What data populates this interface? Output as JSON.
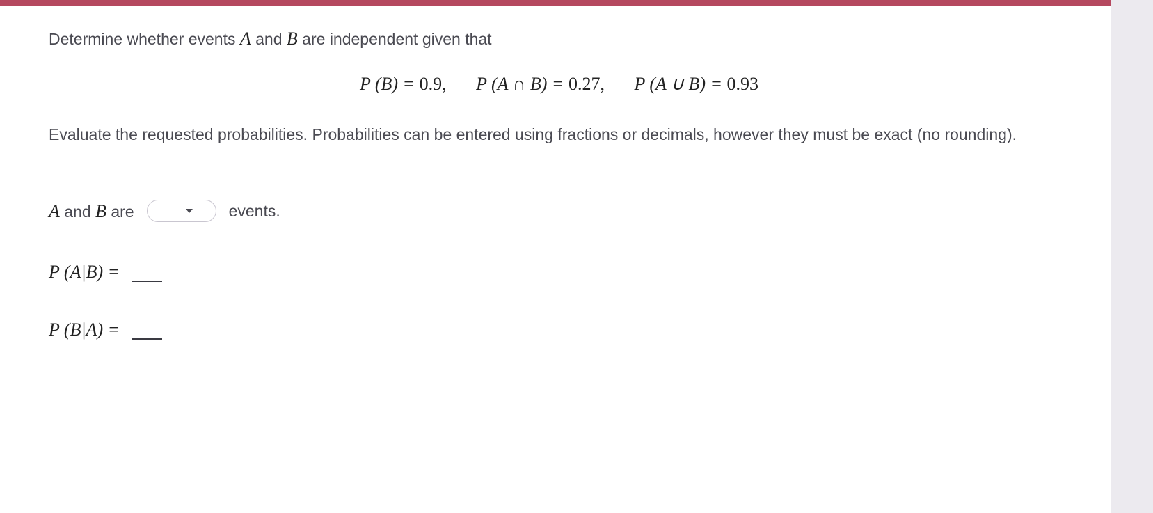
{
  "prompt_intro": "Determine whether events ",
  "var_A": "A",
  "and_word": " and ",
  "var_B": "B",
  "prompt_tail": " are independent given that",
  "given": {
    "pB_label": "P (B) = ",
    "pB_val": "0.9,",
    "pAandB_label": "P (A ∩ B) = ",
    "pAandB_val": "0.27,",
    "pAorB_label": "P (A ∪ B) = ",
    "pAorB_val": "0.93"
  },
  "instructions": "Evaluate the requested probabilities. Probabilities can be entered using fractions or decimals, however they must be exact (no rounding).",
  "sentence": {
    "pre": " are ",
    "post": " events."
  },
  "dropdown": {
    "selected": ""
  },
  "cond1_label": "P (A|B) = ",
  "cond2_label": "P (B|A) = "
}
